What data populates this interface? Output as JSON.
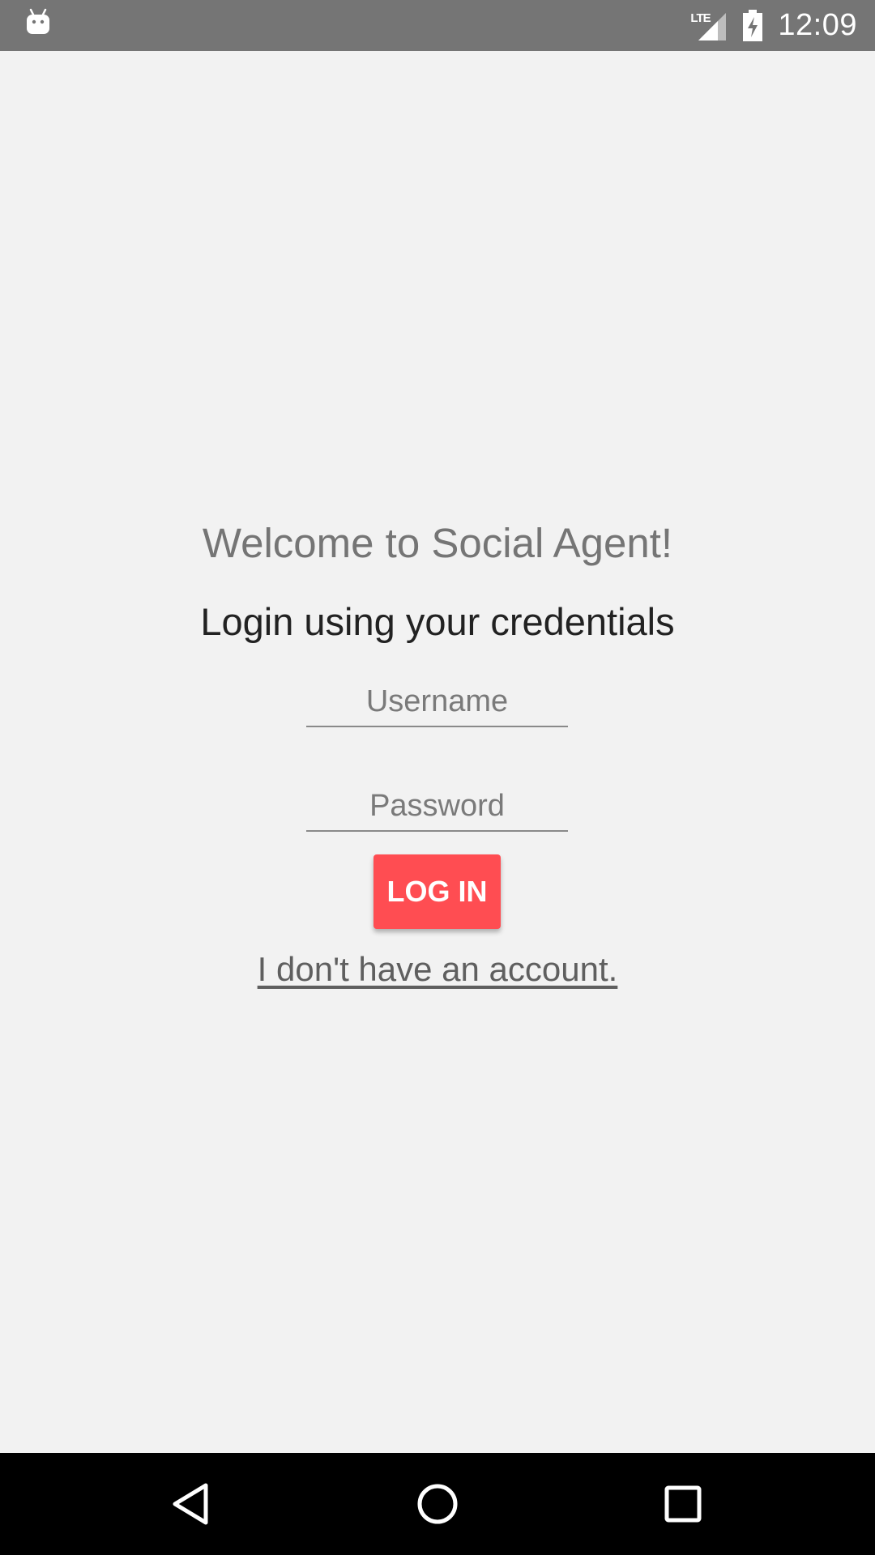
{
  "status_bar": {
    "network_label": "LTE",
    "time": "12:09",
    "icons": [
      "android-icon",
      "lte-signal-icon",
      "battery-charging-icon"
    ]
  },
  "login": {
    "welcome": "Welcome to Social Agent!",
    "subtitle": "Login using your credentials",
    "username_placeholder": "Username",
    "username_value": "",
    "password_placeholder": "Password",
    "password_value": "",
    "login_button": "LOG IN",
    "signup_link": "I don't have an account."
  },
  "nav_bar": {
    "buttons": [
      "back-icon",
      "home-icon",
      "recent-apps-icon"
    ]
  },
  "colors": {
    "accent": "#ff4d52",
    "status_bar": "#757575",
    "background": "#f2f2f2",
    "nav_bar": "#000000"
  }
}
